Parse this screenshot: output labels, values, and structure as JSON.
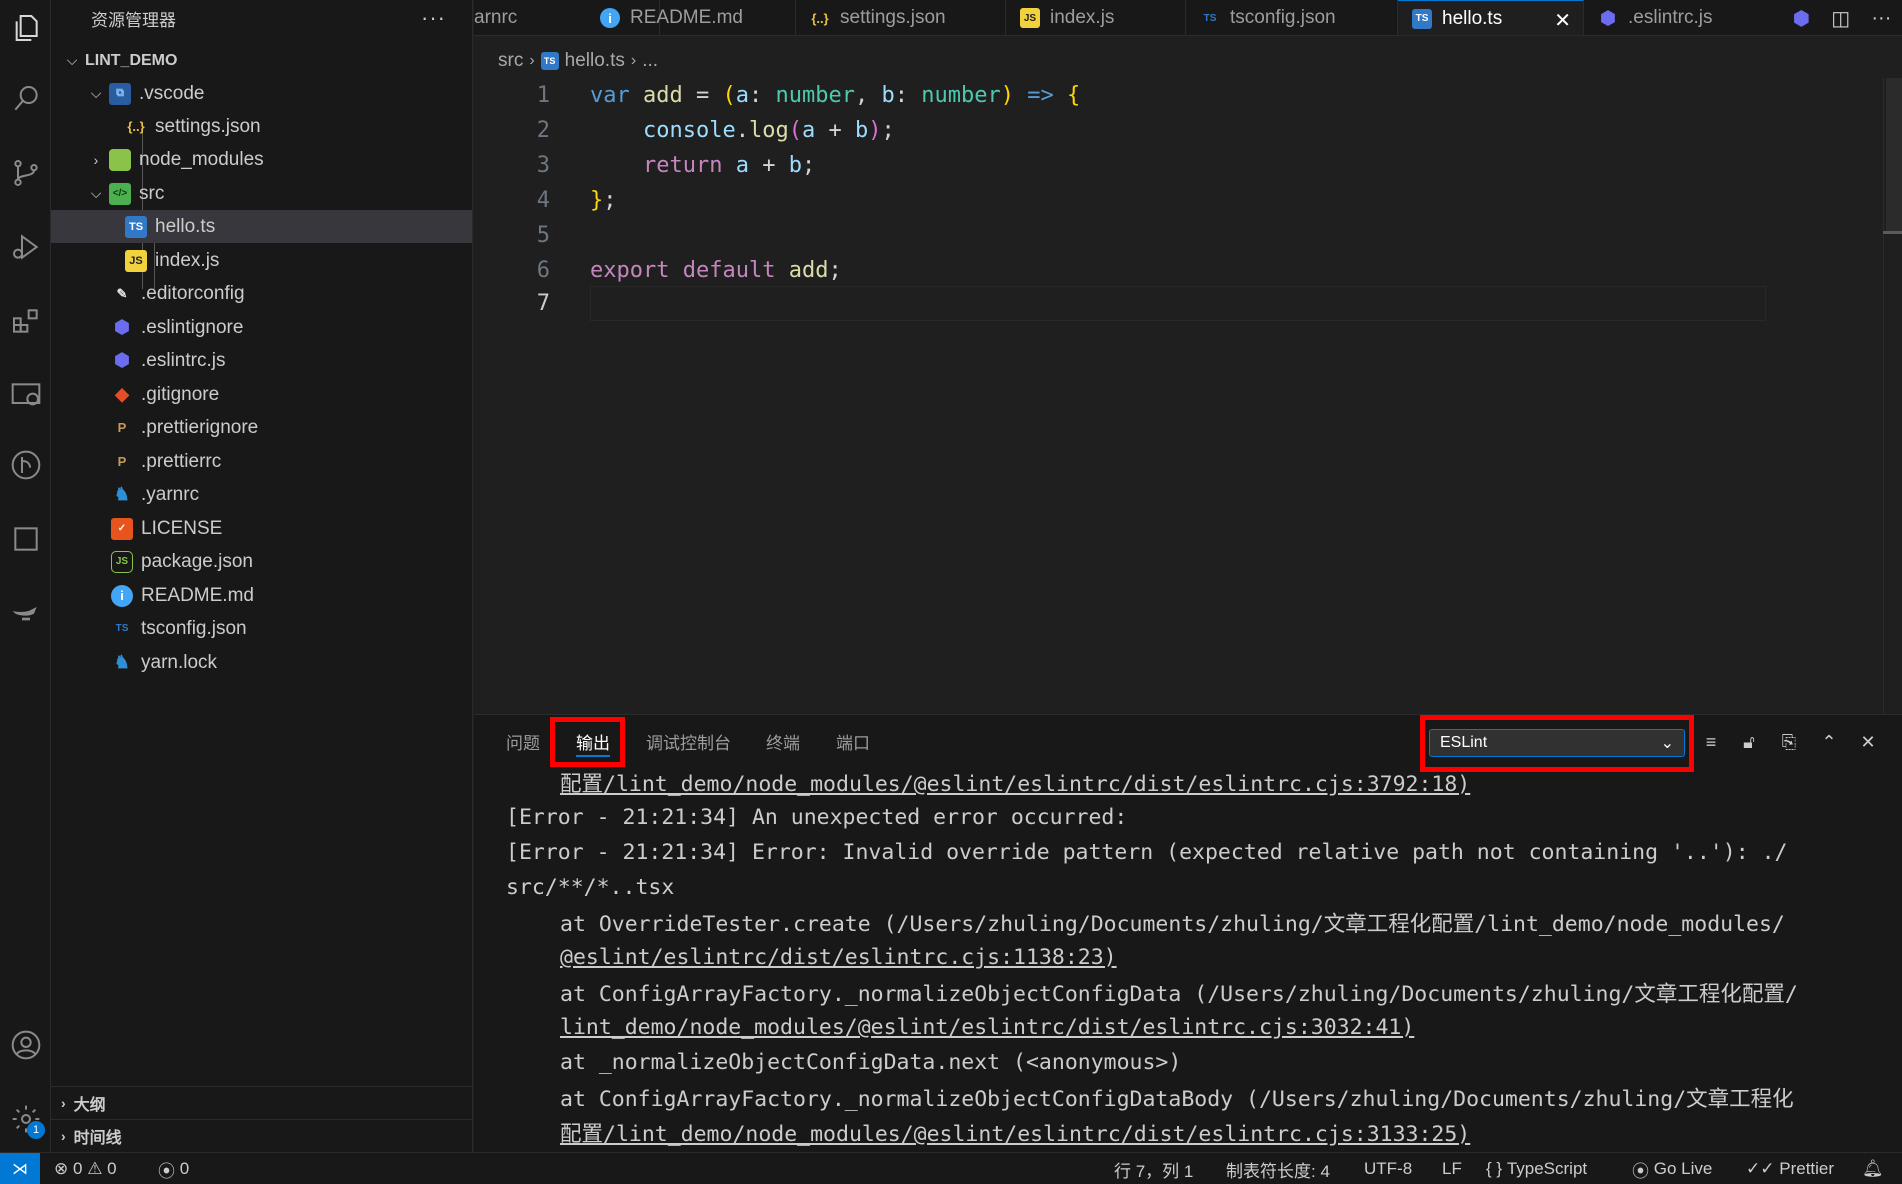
{
  "sidebar": {
    "title": "资源管理器",
    "more": "···",
    "root": "LINT_DEMO",
    "items": [
      {
        "label": ".vscode",
        "icon": "vscode-folder-icon"
      },
      {
        "label": "settings.json",
        "icon": "json-icon"
      },
      {
        "label": "node_modules",
        "icon": "node-folder-icon"
      },
      {
        "label": "src",
        "icon": "src-folder-icon"
      },
      {
        "label": "hello.ts",
        "icon": "ts-icon"
      },
      {
        "label": "index.js",
        "icon": "js-icon"
      },
      {
        "label": ".editorconfig",
        "icon": "editorconfig-icon"
      },
      {
        "label": ".eslintignore",
        "icon": "eslint-icon"
      },
      {
        "label": ".eslintrc.js",
        "icon": "eslint-icon"
      },
      {
        "label": ".gitignore",
        "icon": "git-icon"
      },
      {
        "label": ".prettierignore",
        "icon": "prettier-icon"
      },
      {
        "label": ".prettierrc",
        "icon": "prettier-icon"
      },
      {
        "label": ".yarnrc",
        "icon": "yarn-icon"
      },
      {
        "label": "LICENSE",
        "icon": "license-icon"
      },
      {
        "label": "package.json",
        "icon": "node-icon"
      },
      {
        "label": "README.md",
        "icon": "info-icon"
      },
      {
        "label": "tsconfig.json",
        "icon": "tsconfig-icon"
      },
      {
        "label": "yarn.lock",
        "icon": "yarn-icon"
      }
    ],
    "outline": "大纲",
    "timeline": "时间线"
  },
  "tabs": [
    {
      "label": "arnrc"
    },
    {
      "label": "README.md"
    },
    {
      "label": "settings.json"
    },
    {
      "label": "index.js"
    },
    {
      "label": "tsconfig.json"
    },
    {
      "label": "hello.ts"
    },
    {
      "label": ".eslintrc.js"
    }
  ],
  "breadcrumb": {
    "folder": "src",
    "file": "hello.ts",
    "more": "..."
  },
  "editor": {
    "line_numbers": [
      "1",
      "2",
      "3",
      "4",
      "5",
      "6",
      "7"
    ]
  },
  "panel": {
    "tabs": [
      "问题",
      "输出",
      "调试控制台",
      "终端",
      "端口"
    ],
    "active_tab": "输出",
    "output_channel": "ESLint",
    "output_lines": [
      "配置/lint_demo/node_modules/@eslint/eslintrc/dist/eslintrc.cjs:3792:18)",
      "[Error - 21:21:34] An unexpected error occurred:",
      "[Error - 21:21:34] Error: Invalid override pattern (expected relative path not containing '..'): ./",
      "src/**/*..tsx",
      "at OverrideTester.create (/Users/zhuling/Documents/zhuling/文章工程化配置/lint_demo/node_modules/",
      "@eslint/eslintrc/dist/eslintrc.cjs:1138:23)",
      "at ConfigArrayFactory._normalizeObjectConfigData (/Users/zhuling/Documents/zhuling/文章工程化配置/",
      "lint_demo/node_modules/@eslint/eslintrc/dist/eslintrc.cjs:3032:41)",
      "at _normalizeObjectConfigData.next (<anonymous>)",
      "at ConfigArrayFactory._normalizeObjectConfigDataBody (/Users/zhuling/Documents/zhuling/文章工程化",
      "配置/lint_demo/node_modules/@eslint/eslintrc/dist/eslintrc.cjs:3133:25)"
    ]
  },
  "activity": {
    "settings_badge": "1"
  },
  "status": {
    "errors": "0",
    "warnings": "0",
    "ports": "0",
    "position": "行 7，列 1",
    "tab_size": "制表符长度: 4",
    "encoding": "UTF-8",
    "eol": "LF",
    "language": "TypeScript",
    "golive": "Go Live",
    "prettier": "Prettier"
  },
  "colors": {
    "accent": "#0078d4",
    "highlight_box": "#ff0000"
  }
}
